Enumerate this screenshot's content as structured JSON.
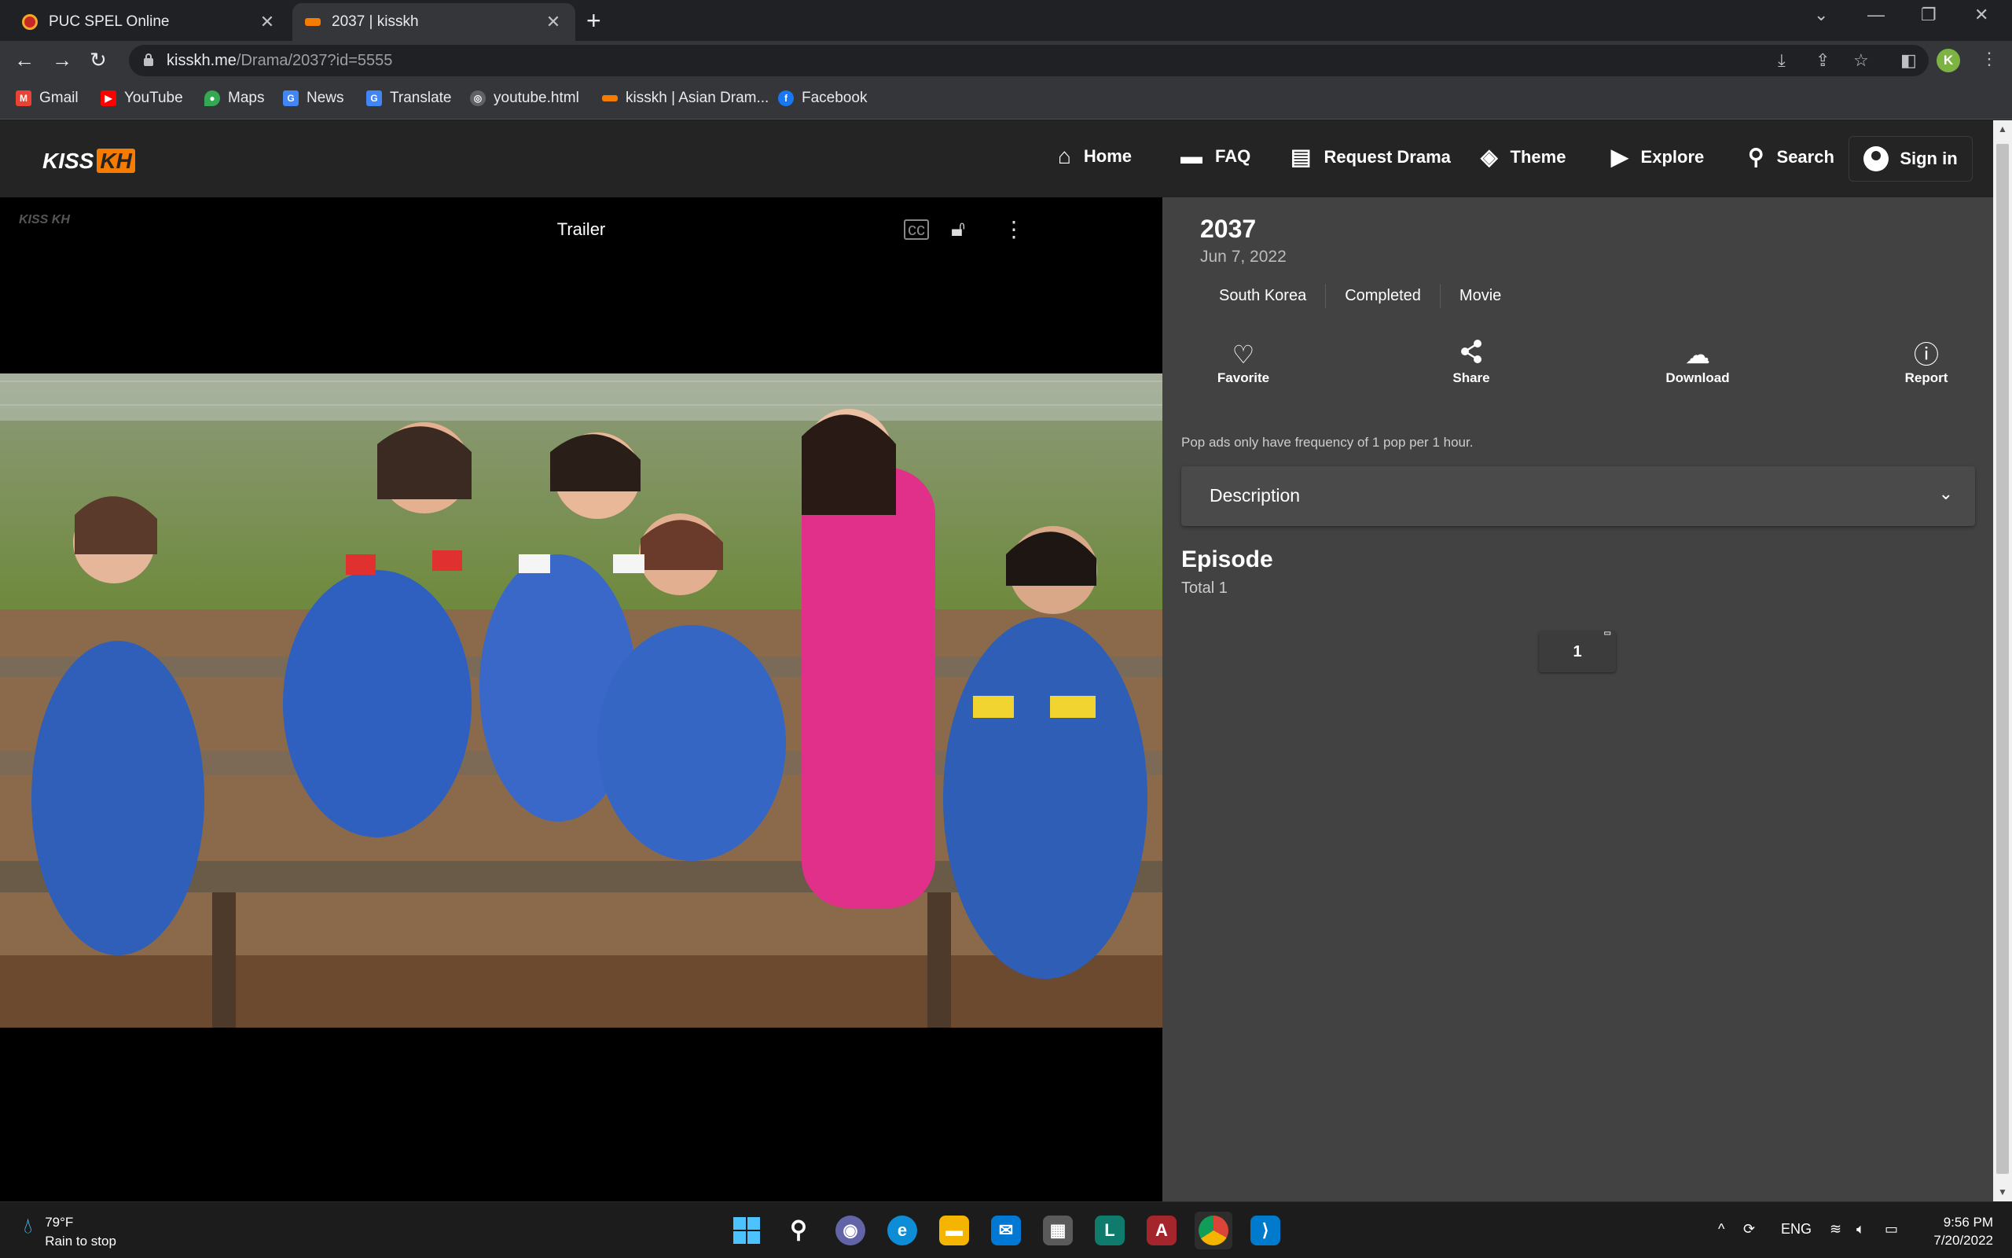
{
  "browser": {
    "tabs": [
      {
        "title": "PUC SPEL Online",
        "active": false,
        "favicon_color": "#c62828"
      },
      {
        "title": "2037 | kisskh",
        "active": true,
        "favicon_color": "#f57c00"
      }
    ],
    "url_host": "kisskh.me",
    "url_path": "/Drama/2037?id=5555",
    "profile_initial": "K",
    "bookmarks": [
      {
        "label": "Gmail",
        "icon": "gmail-icon",
        "glyph": "M",
        "color": "#ea4335"
      },
      {
        "label": "YouTube",
        "icon": "youtube-icon",
        "glyph": "▶",
        "color": "#ff0000"
      },
      {
        "label": "Maps",
        "icon": "maps-icon",
        "glyph": "●",
        "color": "#34a853"
      },
      {
        "label": "News",
        "icon": "news-icon",
        "glyph": "G",
        "color": "#4285f4"
      },
      {
        "label": "Translate",
        "icon": "translate-icon",
        "glyph": "G",
        "color": "#4285f4"
      },
      {
        "label": "youtube.html",
        "icon": "globe-icon",
        "glyph": "◎",
        "color": "#5f6368"
      },
      {
        "label": "kisskh | Asian Dram...",
        "icon": "kisskh-icon",
        "glyph": "k",
        "color": "#f57c00"
      },
      {
        "label": "Facebook",
        "icon": "facebook-icon",
        "glyph": "f",
        "color": "#1877f2"
      }
    ]
  },
  "site": {
    "logo_text": "KISS",
    "logo_badge": "KH",
    "nav": [
      {
        "label": "Home",
        "icon": "home-icon",
        "glyph": "⌂"
      },
      {
        "label": "FAQ",
        "icon": "faq-icon",
        "glyph": "🗨"
      },
      {
        "label": "Request Drama",
        "icon": "request-icon",
        "glyph": "▤"
      },
      {
        "label": "Theme",
        "icon": "theme-icon",
        "glyph": "◈"
      },
      {
        "label": "Explore",
        "icon": "explore-icon",
        "glyph": "▶"
      },
      {
        "label": "Search",
        "icon": "search-icon",
        "glyph": "⚲"
      }
    ],
    "signin_label": "Sign in"
  },
  "player": {
    "watermark": "KISS KH",
    "title": "Trailer"
  },
  "drama": {
    "title": "2037",
    "date": "Jun 7, 2022",
    "tags": [
      "South Korea",
      "Completed",
      "Movie"
    ],
    "actions": [
      {
        "label": "Favorite",
        "icon": "heart-icon",
        "glyph": "♡"
      },
      {
        "label": "Share",
        "icon": "share-icon",
        "glyph": "⋖"
      },
      {
        "label": "Download",
        "icon": "cloud-download-icon",
        "glyph": "☁"
      },
      {
        "label": "Report",
        "icon": "report-icon",
        "glyph": "ⓘ"
      }
    ],
    "pop_note": "Pop ads only have frequency of 1 pop per 1 hour.",
    "description_label": "Description",
    "episode_heading": "Episode",
    "episode_total": "Total 1",
    "episodes": [
      "1"
    ]
  },
  "taskbar": {
    "temperature": "79°F",
    "weather_text": "Rain to stop",
    "language": "ENG",
    "time": "9:56 PM",
    "date": "7/20/2022",
    "apps": [
      {
        "name": "start-icon",
        "glyph": "⊞",
        "color": "#0078d4"
      },
      {
        "name": "search-taskbar-icon",
        "glyph": "⚲",
        "color": "#1c1c1c"
      },
      {
        "name": "teams-chat-icon",
        "glyph": "◉",
        "color": "#6264a7"
      },
      {
        "name": "edge-icon",
        "glyph": "e",
        "color": "#0c8dd6"
      },
      {
        "name": "file-explorer-icon",
        "glyph": "▬",
        "color": "#f4b400"
      },
      {
        "name": "mail-icon",
        "glyph": "✉",
        "color": "#0078d4"
      },
      {
        "name": "store-icon",
        "glyph": "▦",
        "color": "#5a5a5a"
      },
      {
        "name": "l-app-icon",
        "glyph": "L",
        "color": "#0f7b6c"
      },
      {
        "name": "access-icon",
        "glyph": "A",
        "color": "#a4262c"
      },
      {
        "name": "chrome-icon",
        "glyph": "◍",
        "color": "#db4437"
      },
      {
        "name": "vscode-icon",
        "glyph": "⟩",
        "color": "#007acc"
      }
    ]
  },
  "colors": {
    "accent_orange": "#f57c00",
    "info_panel": "#424242",
    "header": "#242424"
  }
}
